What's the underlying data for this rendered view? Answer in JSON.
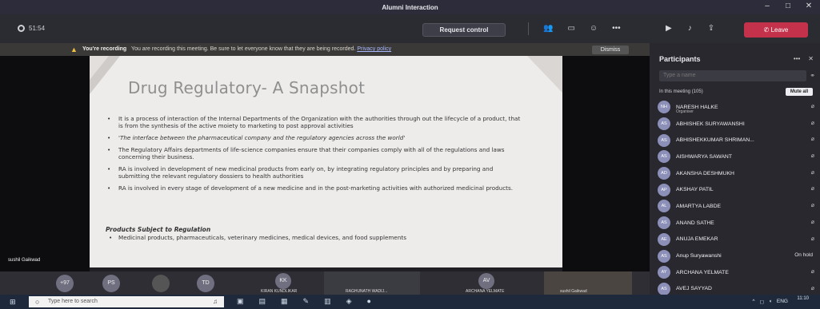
{
  "window": {
    "title": "Alumni Interaction"
  },
  "toolbar": {
    "elapsed_time": "51:54",
    "request_control_label": "Request control",
    "leave_label": "Leave",
    "icons": [
      "people-icon",
      "chat-icon",
      "reactions-icon",
      "more-icon",
      "camera-off-icon",
      "mic-off-icon",
      "share-icon"
    ]
  },
  "banner": {
    "bold": "You're recording",
    "message": "You are recording this meeting. Be sure to let everyone know that they are being recorded.",
    "link": "Privacy policy",
    "dismiss_label": "Dismiss"
  },
  "slide": {
    "title": "Drug Regulatory- A Snapshot",
    "bullets": [
      "It is a process of interaction of the Internal Departments of the Organization with the authorities through out the lifecycle of a product, that is from the synthesis of the active moiety to marketing to post approval activities",
      "'The interface between the pharmaceutical company and the regulatory agencies across the world'",
      "The Regulatory Affairs departments of life-science companies ensure that their companies comply with all of the regulations and laws concerning their business.",
      "RA is involved in development of new medicinal products from early on, by integrating regulatory principles and by preparing and submitting the relevant regulatory dossiers to health authorities",
      "RA is involved in every stage of development of a new medicine and in the post-marketing activities with authorized medicinal products."
    ],
    "products_heading": "Products Subject to Regulation",
    "products_item": "Medicinal products, pharmaceuticals, veterinary medicines, medical devices, and food supplements"
  },
  "presenter": {
    "name": "sushil Gaikwad"
  },
  "participants": {
    "header": "Participants",
    "search_placeholder": "Type a name",
    "in_meeting": "In this meeting (105)",
    "mute_all_label": "Mute all",
    "list": [
      {
        "initials": "NH",
        "name": "NARESH HALKE",
        "role": "Organiser",
        "status": ""
      },
      {
        "initials": "AS",
        "name": "ABHISHEK SURYAWANSHI",
        "role": "",
        "status": ""
      },
      {
        "initials": "AS",
        "name": "ABHISHEKKUMAR SHRIMAN...",
        "role": "",
        "status": ""
      },
      {
        "initials": "AS",
        "name": "AISHWARYA SAWANT",
        "role": "",
        "status": ""
      },
      {
        "initials": "AD",
        "name": "AKANSHA DESHMUKH",
        "role": "",
        "status": ""
      },
      {
        "initials": "AP",
        "name": "AKSHAY PATIL",
        "role": "",
        "status": ""
      },
      {
        "initials": "AL",
        "name": "AMARTYA LABDE",
        "role": "",
        "status": ""
      },
      {
        "initials": "AS",
        "name": "ANAND SATHE",
        "role": "",
        "status": ""
      },
      {
        "initials": "AE",
        "name": "ANUJA EMEKAR",
        "role": "",
        "status": ""
      },
      {
        "initials": "AS",
        "name": "Anup Suryawanshi",
        "role": "",
        "status": "On hold"
      },
      {
        "initials": "AY",
        "name": "ARCHANA YELMATE",
        "role": "",
        "status": ""
      },
      {
        "initials": "AS",
        "name": "AVEJ SAYYAD",
        "role": "",
        "status": ""
      }
    ]
  },
  "strip": {
    "more_count": "+97",
    "tiles": [
      {
        "initials": "PS"
      },
      {
        "initials": "TD"
      },
      {
        "initials": "KK",
        "name": "KIRAN KUNDLIKAR"
      },
      {
        "initials": "",
        "name": "RAGHUNATH WADIJ..."
      },
      {
        "initials": "AV",
        "name": "ARCHANA YELMATE"
      },
      {
        "initials": "",
        "name": "sushil Gaikwad"
      }
    ]
  },
  "taskbar": {
    "search_placeholder": "Type here to search",
    "language": "ENG",
    "time": "11:10"
  }
}
